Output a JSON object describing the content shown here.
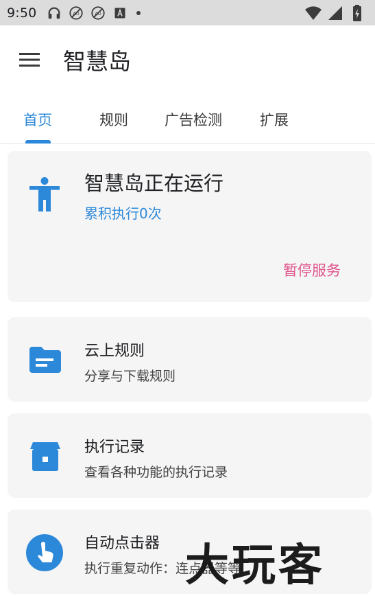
{
  "status_bar": {
    "time": "9:50",
    "icons_left": [
      "headphones-icon",
      "no-signal-icon",
      "no-signal-icon",
      "text-icon",
      "dot-icon"
    ],
    "icons_right": [
      "wifi-icon",
      "cell-signal-icon",
      "battery-icon"
    ]
  },
  "app_bar": {
    "menu_icon": "hamburger-menu-icon",
    "title": "智慧岛"
  },
  "tabs": [
    {
      "label": "首页",
      "active": true
    },
    {
      "label": "规则",
      "active": false
    },
    {
      "label": "广告检测",
      "active": false
    },
    {
      "label": "扩展",
      "active": false
    }
  ],
  "status_card": {
    "icon": "accessibility-icon",
    "title": "智慧岛正在运行",
    "count_text": "累积执行0次",
    "pause_label": "暂停服务"
  },
  "feature_cards": [
    {
      "icon": "folder-icon",
      "title": "云上规则",
      "subtitle": "分享与下载规则"
    },
    {
      "icon": "archive-icon",
      "title": "执行记录",
      "subtitle": "查看各种功能的执行记录"
    },
    {
      "icon": "tap-hand-icon",
      "title": "自动点击器",
      "subtitle": "执行重复动作：连点器等等"
    }
  ],
  "watermark": "大玩客",
  "colors": {
    "accent_blue": "#2c88d9",
    "pause_pink": "#e0568e",
    "card_bg": "#f5f5f5",
    "status_bar_bg": "#dcdcdc"
  }
}
